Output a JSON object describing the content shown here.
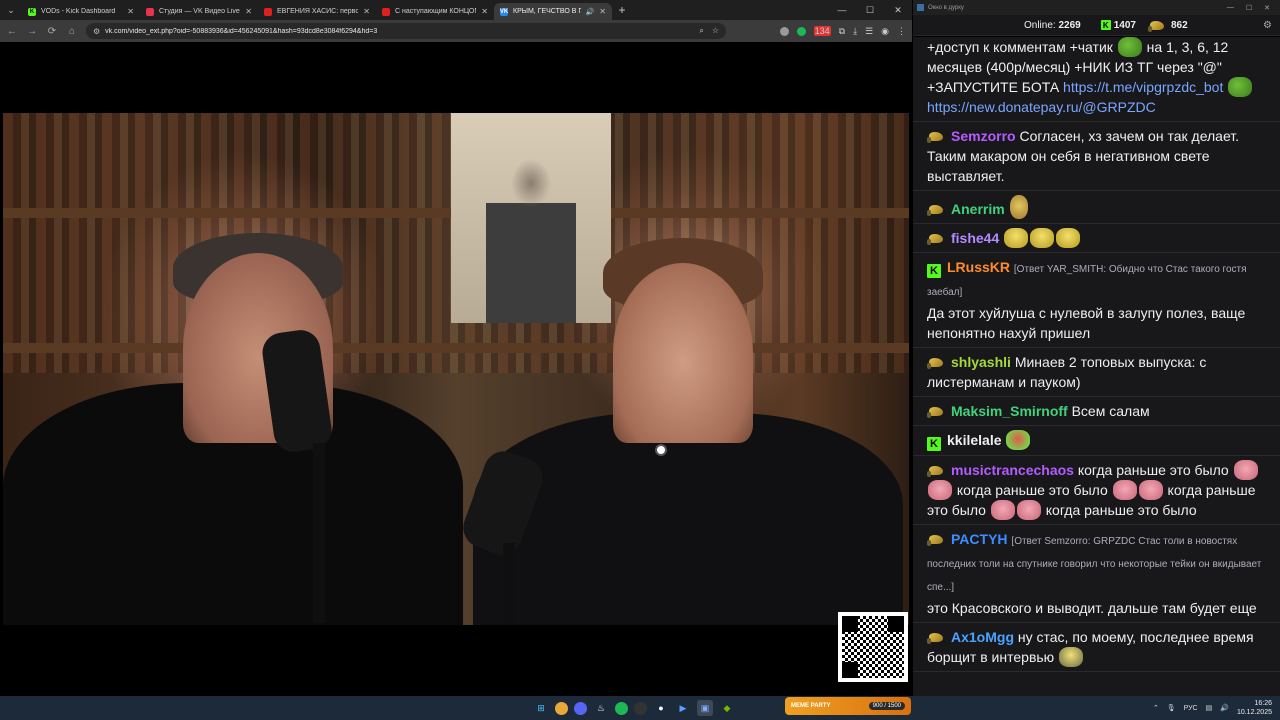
{
  "browser": {
    "tabs": [
      {
        "title": "VODs - Kick Dashboard",
        "favicon_color": "#53fc18",
        "favicon_glyph": "K"
      },
      {
        "title": "Студия — VK Видео Live",
        "favicon_color": "#e8334a",
        "favicon_glyph": ""
      },
      {
        "title": "ЕВГЕНИЯ ХАСИС: первое инте...",
        "favicon_color": "#e02020",
        "favicon_glyph": ""
      },
      {
        "title": "С наступающим КОНЦОМ СВ...",
        "favicon_color": "#e02020",
        "favicon_glyph": ""
      },
      {
        "title": "КРЫМ, ГЕЧСТВО В ПОЛИТ...",
        "favicon_color": "#2787f5",
        "favicon_glyph": "VK",
        "active": true
      }
    ],
    "url": "vk.com/video_ext.php?oid=-50883936&id=456245091&hash=93dcd8e3084f6294&hd=3",
    "extension_badge": "134"
  },
  "chat_window": {
    "title": "Окно в дурку"
  },
  "chat_header": {
    "online_label": "Online:",
    "online_count": "2269",
    "kick_count": "1407",
    "crown_count": "862"
  },
  "messages": [
    {
      "id": "m0",
      "text_a": "+доступ к комментам +чатик",
      "text_b": "на 1, 3, 6, 12 месяцев (400р/месяц) +НИК ИЗ ТГ через \"@\" +ЗАПУСТИТЕ БОТА",
      "link1": "https://t.me/vipgrpzdc_bot",
      "link2": "https://new.donatepay.ru/@GRPZDC"
    },
    {
      "id": "m1",
      "user": "Semzorro",
      "color": "#b45cff",
      "text": "Согласен, хз зачем он так делает. Таким макаром он себя в негативном свете выставляет."
    },
    {
      "id": "m2",
      "user": "Anerrim",
      "color": "#3fd37a",
      "text": ""
    },
    {
      "id": "m3",
      "user": "fishe44",
      "color": "#b28bff",
      "text": ""
    },
    {
      "id": "m4",
      "user": "LRussKR",
      "color": "#ff8b2b",
      "reply": "[Ответ YAR_SMITH: Обидно что Стас такого гостя заебал]",
      "text": "Да этот хуйлуша с нулевой в залупу полез, ваще непонятно нахуй пришел"
    },
    {
      "id": "m5",
      "user": "shlyashli",
      "color": "#a4d93a",
      "text": "Минаев 2 топовых выпуска: с листерманам и пауком)"
    },
    {
      "id": "m6",
      "user": "Maksim_Smirnoff",
      "color": "#3fd37a",
      "text": "Всем салам"
    },
    {
      "id": "m7",
      "user": "kkilelale",
      "color": "#efeff1",
      "text": ""
    },
    {
      "id": "m8",
      "user": "musictrancechaos",
      "color": "#b45cff",
      "text": "когда раньше это было",
      "text2": "когда раньше это было",
      "text3": "когда раньше это было",
      "text4": "когда раньше это было"
    },
    {
      "id": "m9",
      "user": "PACTYH",
      "color": "#3c8dff",
      "reply": "[Ответ Semzorro: GRPZDC  Стас толи в новостях последних толи на спутнике говорил что некоторые тейки он вкидывает спе...]",
      "text": "это Красовского и выводит. дальше там будет еще"
    },
    {
      "id": "m10",
      "user": "Ax1oMgg",
      "color": "#4aa3ff",
      "text": "ну стас, по моему, последнее время борщит в интервью"
    }
  ],
  "taskbar": {
    "widget_label": "MEME PARTY",
    "widget_count": "900 / 1500",
    "lang": "РУС",
    "time": "16:26",
    "date": "10.12.2025"
  }
}
